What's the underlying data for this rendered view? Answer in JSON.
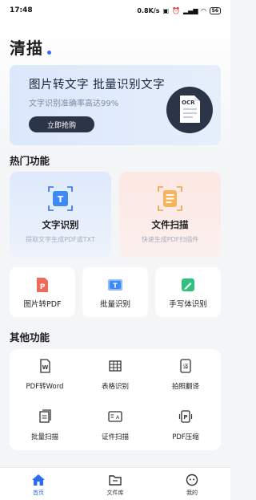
{
  "status_bar": {
    "time": "17:48",
    "speed": "0.8K/s",
    "battery": "56"
  },
  "header": {
    "title": "清描"
  },
  "banner": {
    "title": "图片转文字 批量识别文字",
    "subtitle": "文字识别准确率高达99%",
    "button_label": "立即抢购",
    "ocr_label": "OCR"
  },
  "hot": {
    "section_title": "热门功能",
    "cards": [
      {
        "label": "文字识别",
        "desc": "提取文字生成PDF或TXT",
        "icon": "text-recognition-icon",
        "glyph": "T"
      },
      {
        "label": "文件扫描",
        "desc": "快速生成PDF扫描件",
        "icon": "document-scan-icon"
      }
    ]
  },
  "tools": [
    {
      "label": "图片转PDF",
      "icon": "pdf-icon",
      "glyph": "P"
    },
    {
      "label": "批量识别",
      "icon": "batch-recognition-icon",
      "glyph": "T"
    },
    {
      "label": "手写体识别",
      "icon": "handwriting-icon"
    }
  ],
  "other": {
    "section_title": "其他功能",
    "items": [
      {
        "label": "PDF转Word",
        "icon": "pdf-to-word-icon",
        "glyph": "W"
      },
      {
        "label": "表格识别",
        "icon": "table-icon"
      },
      {
        "label": "拍照翻译",
        "icon": "translate-icon",
        "glyph": "译"
      },
      {
        "label": "批量扫描",
        "icon": "batch-scan-icon"
      },
      {
        "label": "证件扫描",
        "icon": "id-card-icon",
        "glyph": "A"
      },
      {
        "label": "PDF压缩",
        "icon": "pdf-compress-icon",
        "glyph": "P"
      }
    ]
  },
  "nav": [
    {
      "label": "首页",
      "icon": "home-icon",
      "active": true
    },
    {
      "label": "文件库",
      "icon": "folder-icon",
      "active": false
    },
    {
      "label": "我的",
      "icon": "profile-icon",
      "active": false
    }
  ],
  "colors": {
    "accent": "#2f6cf6",
    "banner_button": "#2c3448",
    "pdf_red": "#f06a5a",
    "green": "#2ec27e"
  }
}
